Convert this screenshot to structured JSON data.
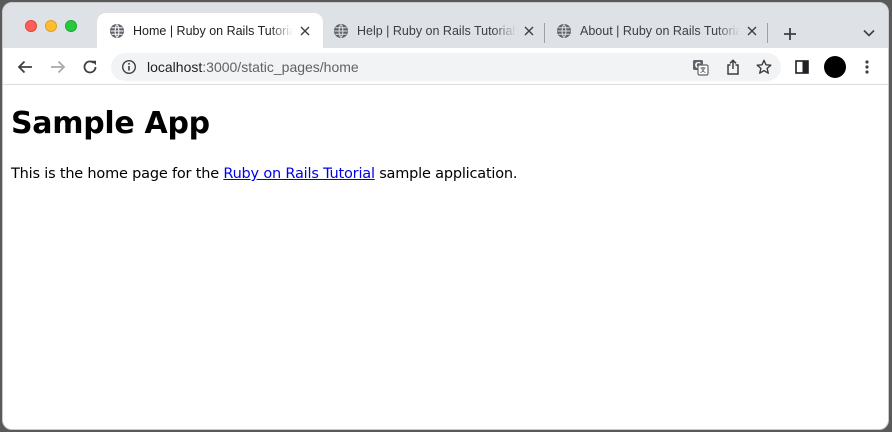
{
  "tabs": [
    {
      "title": "Home | Ruby on Rails Tutorial Sample App",
      "active": true
    },
    {
      "title": "Help | Ruby on Rails Tutorial Sample App",
      "active": false
    },
    {
      "title": "About | Ruby on Rails Tutorial Sample App",
      "active": false
    }
  ],
  "omnibox": {
    "host": "localhost",
    "rest": ":3000/static_pages/home"
  },
  "page": {
    "heading": "Sample App",
    "text_before": "This is the home page for the ",
    "link_text": "Ruby on Rails Tutorial",
    "text_after": " sample application."
  },
  "icons": {
    "tab_favicon": "globe-icon",
    "tab_close": "close-icon",
    "new_tab": "plus-icon",
    "tab_search": "chevron-down-icon",
    "back": "arrow-left-icon",
    "forward": "arrow-right-icon",
    "reload": "reload-icon",
    "site_info": "info-icon",
    "translate": "translate-icon",
    "share": "share-icon",
    "bookmark": "star-icon",
    "side_panel": "side-panel-icon",
    "profile": "avatar",
    "menu": "kebab-menu-icon"
  },
  "colors": {
    "tabstrip_bg": "#dee1e6",
    "omnibox_bg": "#f1f3f4",
    "link": "#0000ee",
    "close_button": "#fe5f57",
    "minimize_button": "#febc2e",
    "zoom_button": "#28c840"
  }
}
